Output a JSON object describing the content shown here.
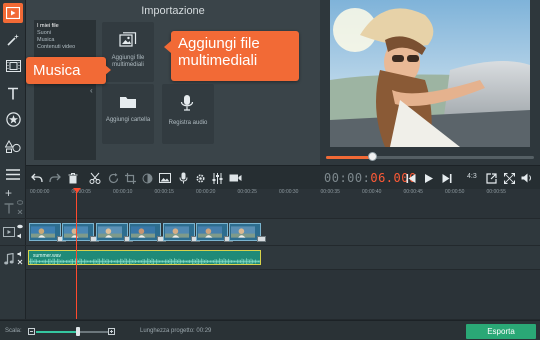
{
  "import_panel": {
    "title": "Importazione",
    "categories": [
      "I miei file",
      "Suoni",
      "Musica",
      "Contenuti video"
    ],
    "collapse_glyph": "‹",
    "buttons": {
      "add_files": "Aggiungi file multimediali",
      "add_folder": "Aggiungi cartella",
      "record_audio": "Registra audio"
    }
  },
  "callouts": {
    "music": "Musica",
    "add_files": "Aggiungi file multimediali"
  },
  "preview": {
    "seek_progress": 0.22
  },
  "toolbar": {
    "timecode_dim": "00:00:",
    "timecode_hi": "06.000",
    "aspect_ratio": "4:3"
  },
  "ruler": {
    "ticks": [
      "00:00:00",
      "00:00:05",
      "00:00:10",
      "00:00:15",
      "00:00:20",
      "00:00:25",
      "00:00:30",
      "00:00:35",
      "00:00:40",
      "00:00:45",
      "00:00:50",
      "00:00:55"
    ]
  },
  "timeline": {
    "video_clip_count": 7,
    "audio_clip_name": "summer.wav",
    "add_track_glyph": "+"
  },
  "bottom_bar": {
    "scale_label": "Scala:",
    "zoom_level": 0.58,
    "project_length": "Lunghezza progetto:  00:29",
    "export_label": "Esporta"
  },
  "colors": {
    "accent": "#f26a36",
    "export_green": "#2aa876",
    "audio_clip": "#1f8a78",
    "video_clip": "#2d6d8f",
    "playhead": "#ff4a2e"
  },
  "icons": [
    "media-import-icon",
    "magic-wand-icon",
    "filmstrip-icon",
    "text-icon",
    "star-icon",
    "shapes-icon",
    "menu-icon"
  ]
}
